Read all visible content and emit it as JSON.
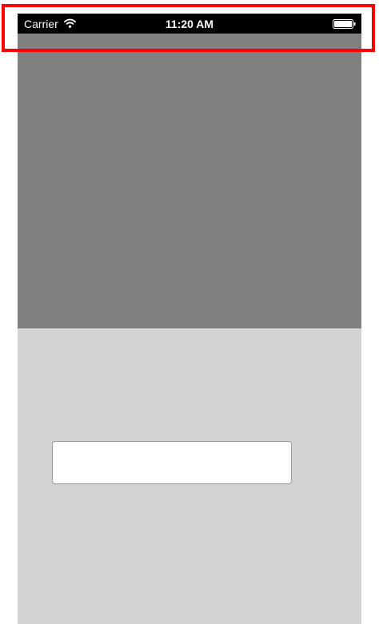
{
  "status_bar": {
    "carrier": "Carrier",
    "time": "11:20 AM",
    "wifi_icon": "wifi-icon",
    "battery_icon": "battery-icon"
  },
  "top_panel": {
    "color": "#808080"
  },
  "bottom_panel": {
    "color": "#d3d3d3"
  },
  "text_field": {
    "value": "",
    "placeholder": ""
  },
  "annotation": {
    "highlight_color": "#ff0000"
  }
}
